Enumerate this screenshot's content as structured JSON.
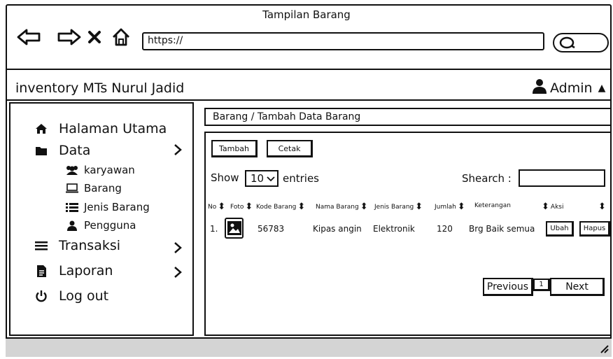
{
  "window": {
    "title": "Tampilan Barang"
  },
  "browser": {
    "url": "https://"
  },
  "app": {
    "name": "inventory MTs Nurul Jadid",
    "user": "Admin"
  },
  "sidebar": {
    "items": [
      {
        "label": "Halaman Utama",
        "icon": "home-icon"
      },
      {
        "label": "Data",
        "icon": "folder-icon"
      },
      {
        "label": "Transaksi",
        "icon": "list-icon"
      },
      {
        "label": "Laporan",
        "icon": "document-icon"
      },
      {
        "label": "Log out",
        "icon": "power-icon"
      }
    ],
    "data_sub": [
      {
        "label": "karyawan",
        "icon": "users-icon"
      },
      {
        "label": "Barang",
        "icon": "laptop-icon"
      },
      {
        "label": "Jenis Barang",
        "icon": "list-ul-icon"
      },
      {
        "label": "Pengguna",
        "icon": "user-icon"
      }
    ]
  },
  "breadcrumb": "Barang / Tambah Data Barang",
  "toolbar": {
    "add_label": "Tambah",
    "print_label": "Cetak"
  },
  "table_controls": {
    "show_label": "Show",
    "entries_value": "10",
    "entries_label": "entries",
    "search_label": "Shearch :"
  },
  "table": {
    "columns": [
      "No",
      "Foto",
      "Kode Barang",
      "Nama Barang",
      "Jenis Barang",
      "Jumlah",
      "Keterangan",
      "Aksi"
    ],
    "rows": [
      {
        "no": "1.",
        "kode": "56783",
        "nama": "Kipas angin",
        "jenis": "Elektronik",
        "jumlah": "120",
        "keterangan": "Brg Baik semua",
        "edit_label": "Ubah",
        "delete_label": "Hapus"
      }
    ]
  },
  "pagination": {
    "previous": "Previous",
    "page": "1",
    "next": "Next"
  }
}
